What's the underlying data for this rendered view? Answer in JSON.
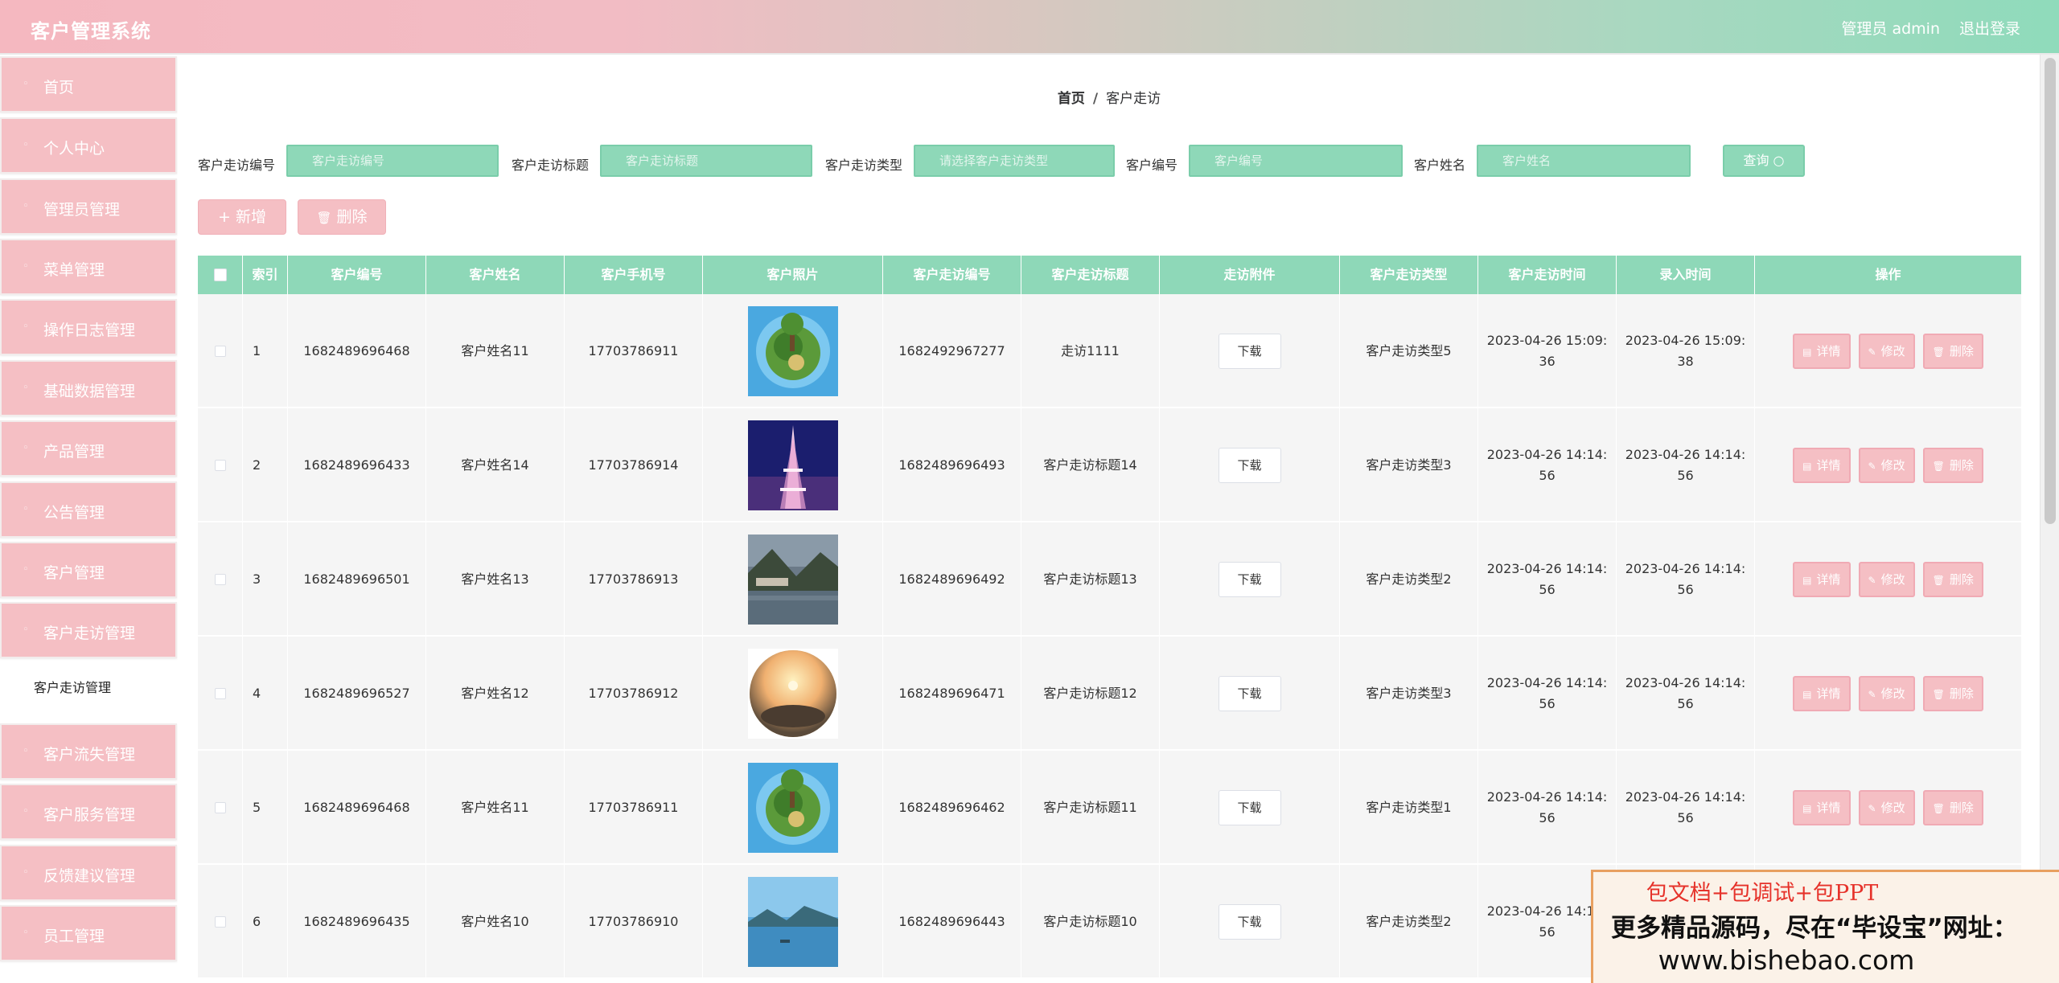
{
  "app": {
    "title": "客户管理系统",
    "admin_label": "管理员 admin",
    "logout_label": "退出登录"
  },
  "sidebar": {
    "items": [
      {
        "label": "首页"
      },
      {
        "label": "个人中心"
      },
      {
        "label": "管理员管理"
      },
      {
        "label": "菜单管理"
      },
      {
        "label": "操作日志管理"
      },
      {
        "label": "基础数据管理"
      },
      {
        "label": "产品管理"
      },
      {
        "label": "公告管理"
      },
      {
        "label": "客户管理"
      },
      {
        "label": "客户走访管理"
      },
      {
        "label": "客户流失管理"
      },
      {
        "label": "客户服务管理"
      },
      {
        "label": "反馈建议管理"
      },
      {
        "label": "员工管理"
      }
    ],
    "submenu_active": "客户走访管理"
  },
  "breadcrumb": {
    "home": "首页",
    "separator": "/",
    "current": "客户走访"
  },
  "search": {
    "fields": [
      {
        "label": "客户走访编号",
        "placeholder": "客户走访编号"
      },
      {
        "label": "客户走访标题",
        "placeholder": "客户走访标题"
      },
      {
        "label": "客户走访类型",
        "placeholder": "请选择客户走访类型"
      },
      {
        "label": "客户编号",
        "placeholder": "客户编号"
      },
      {
        "label": "客户姓名",
        "placeholder": "客户姓名"
      }
    ],
    "button_label": "查询 ○"
  },
  "actions": {
    "add_label": "+ 新增",
    "delete_label": "删除"
  },
  "table": {
    "headers": [
      "索引",
      "客户编号",
      "客户姓名",
      "客户手机号",
      "客户照片",
      "客户走访编号",
      "客户走访标题",
      "走访附件",
      "客户走访类型",
      "客户走访时间",
      "录入时间",
      "操作"
    ],
    "download_label": "下载",
    "op_detail": "详情",
    "op_edit": "修改",
    "op_delete": "删除",
    "rows": [
      {
        "index": "1",
        "customer_no": "1682489696468",
        "name": "客户姓名11",
        "phone": "17703786911",
        "photo": "sphere-landscape",
        "visit_no": "1682492967277",
        "visit_title": "走访1111",
        "visit_type": "客户走访类型5",
        "visit_time": "2023-04-26 15:09:36",
        "entry_time": "2023-04-26 15:09:38"
      },
      {
        "index": "2",
        "customer_no": "1682489696433",
        "name": "客户姓名14",
        "phone": "17703786914",
        "photo": "eiffel-tower-night",
        "visit_no": "1682489696493",
        "visit_title": "客户走访标题14",
        "visit_type": "客户走访类型3",
        "visit_time": "2023-04-26 14:14:56",
        "entry_time": "2023-04-26 14:14:56"
      },
      {
        "index": "3",
        "customer_no": "1682489696501",
        "name": "客户姓名13",
        "phone": "17703786913",
        "photo": "lake-village",
        "visit_no": "1682489696492",
        "visit_title": "客户走访标题13",
        "visit_type": "客户走访类型2",
        "visit_time": "2023-04-26 14:14:56",
        "entry_time": "2023-04-26 14:14:56"
      },
      {
        "index": "4",
        "customer_no": "1682489696527",
        "name": "客户姓名12",
        "phone": "17703786912",
        "photo": "sunset-sphere",
        "visit_no": "1682489696471",
        "visit_title": "客户走访标题12",
        "visit_type": "客户走访类型3",
        "visit_time": "2023-04-26 14:14:56",
        "entry_time": "2023-04-26 14:14:56"
      },
      {
        "index": "5",
        "customer_no": "1682489696468",
        "name": "客户姓名11",
        "phone": "17703786911",
        "photo": "sphere-landscape",
        "visit_no": "1682489696462",
        "visit_title": "客户走访标题11",
        "visit_type": "客户走访类型1",
        "visit_time": "2023-04-26 14:14:56",
        "entry_time": "2023-04-26 14:14:56"
      },
      {
        "index": "6",
        "customer_no": "1682489696435",
        "name": "客户姓名10",
        "phone": "17703786910",
        "photo": "blue-lake",
        "visit_no": "1682489696443",
        "visit_title": "客户走访标题10",
        "visit_type": "客户走访类型2",
        "visit_time": "2023-04-26 14:14:56",
        "entry_time": ""
      }
    ]
  },
  "ad": {
    "line1": "包文档+包调试+包PPT",
    "line2": "更多精品源码，尽在“毕设宝”网址：",
    "line3": "www.bishebao.com"
  },
  "colors": {
    "header_pink": "#f5b8c0",
    "header_green": "#8fdbbb",
    "menu_pink": "#f5bfc4",
    "table_header_green": "#8ed8b8",
    "row_bg": "#f5f5f5",
    "ad_red": "#e6322a"
  }
}
